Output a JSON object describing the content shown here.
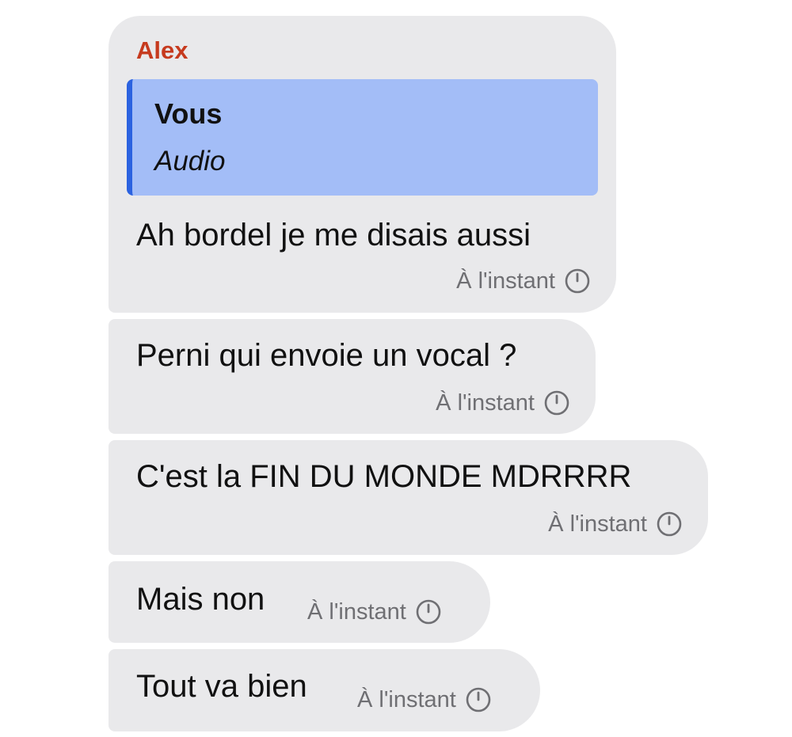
{
  "conversation": {
    "sender_name": "Alex",
    "reply": {
      "author": "Vous",
      "preview": "Audio"
    },
    "messages": [
      {
        "text": "Ah bordel je me disais aussi",
        "time": "À l'instant",
        "status_icon": "clock-icon"
      },
      {
        "text": "Perni qui envoie un vocal ?",
        "time": "À l'instant",
        "status_icon": "clock-icon"
      },
      {
        "text": "C'est la FIN DU MONDE MDRRRR",
        "time": "À l'instant",
        "status_icon": "clock-icon"
      },
      {
        "text": "Mais non",
        "time": "À l'instant",
        "status_icon": "clock-icon"
      },
      {
        "text": "Tout va bien",
        "time": "À l'instant",
        "status_icon": "clock-icon"
      }
    ]
  },
  "colors": {
    "bubble": "#e9e9eb",
    "sender": "#c63a1e",
    "quote_background": "#a3bdf7",
    "quote_bar": "#2b62e0",
    "timestamp": "#6f6f73"
  }
}
